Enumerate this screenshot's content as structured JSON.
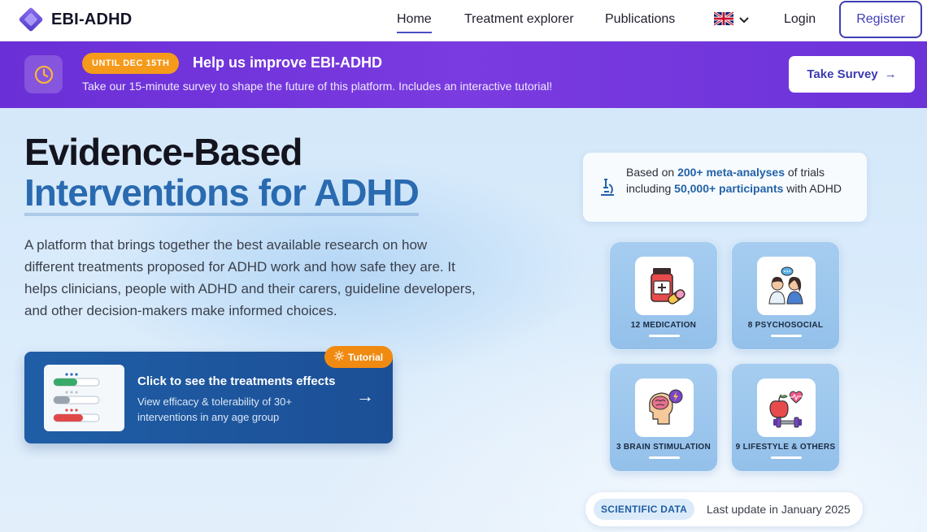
{
  "nav": {
    "brand": "EBI-ADHD",
    "links": [
      "Home",
      "Treatment explorer",
      "Publications"
    ],
    "active": "Home",
    "login": "Login",
    "register": "Register",
    "language_icon": "uk-flag-icon"
  },
  "banner": {
    "badge": "UNTIL DEC 15TH",
    "title": "Help us improve EBI-ADHD",
    "description": "Take our 15-minute survey to shape the future of this platform. Includes an interactive tutorial!",
    "button": "Take Survey",
    "button_arrow": "→",
    "icon": "clock-icon",
    "color": "#6a2fd6",
    "badge_color": "#f59a1a"
  },
  "hero": {
    "title_line1": "Evidence-Based",
    "title_line2": "Interventions for ADHD",
    "intro": "A platform that brings together the best available research on how different treatments proposed for ADHD work and how safe they are. It helps clinicians, people with ADHD and their carers, guideline developers, and other decision-makers make informed choices.",
    "accent_color": "#2a6ab0"
  },
  "cta": {
    "badge": "Tutorial",
    "title": "Click to see the treatments effects",
    "description": "View efficacy & tolerability of 30+ interventions in any age group",
    "arrow": "→",
    "color": "#1f5ea6"
  },
  "evidence": {
    "prefix": "Based on ",
    "highlight1": "200+ meta-analyses",
    "middle": " of trials including ",
    "highlight2": "50,000+ participants",
    "suffix": " with ADHD",
    "icon": "microscope-icon"
  },
  "categories": [
    {
      "label": "12 MEDICATION",
      "icon": "medication-icon"
    },
    {
      "label": "8 PSYCHOSOCIAL",
      "icon": "psychosocial-icon"
    },
    {
      "label": "3 BRAIN STIMULATION",
      "icon": "brain-stimulation-icon"
    },
    {
      "label": "9 LIFESTYLE & OTHERS",
      "icon": "lifestyle-icon"
    }
  ],
  "update": {
    "badge": "SCIENTIFIC DATA",
    "text": "Last update in January 2025"
  }
}
